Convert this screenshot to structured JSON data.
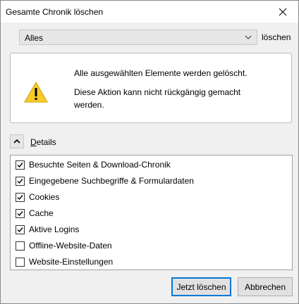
{
  "window": {
    "title": "Gesamte Chronik löschen"
  },
  "range": {
    "selected": "Alles",
    "suffix_label": "löschen"
  },
  "warning": {
    "line1": "Alle ausgewählten Elemente werden gelöscht.",
    "line2": "Diese Aktion kann nicht rückgängig gemacht werden."
  },
  "details": {
    "label_first": "D",
    "label_rest": "etails",
    "expanded": true
  },
  "items": [
    {
      "label": "Besuchte Seiten & Download-Chronik",
      "checked": true
    },
    {
      "label": "Eingegebene Suchbegriffe & Formulardaten",
      "checked": true
    },
    {
      "label": "Cookies",
      "checked": true
    },
    {
      "label": "Cache",
      "checked": true
    },
    {
      "label": "Aktive Logins",
      "checked": true
    },
    {
      "label": "Offline-Website-Daten",
      "checked": false
    },
    {
      "label": "Website-Einstellungen",
      "checked": false
    }
  ],
  "buttons": {
    "clear": "Jetzt löschen",
    "cancel": "Abbrechen"
  },
  "colors": {
    "focus_border": "#0078d7",
    "warning_yellow": "#f7cb2a"
  },
  "icons": {
    "close": "close-icon",
    "dropdown": "chevron-down-icon",
    "warning": "warning-icon",
    "collapse": "chevron-up-icon"
  }
}
